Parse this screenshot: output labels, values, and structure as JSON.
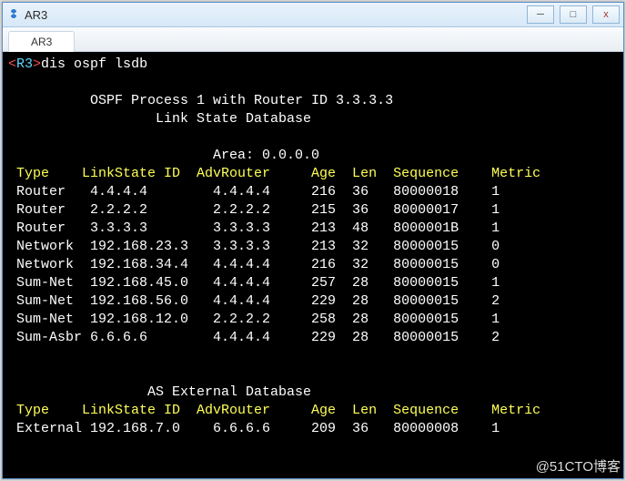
{
  "window": {
    "title": "AR3"
  },
  "tabs": [
    {
      "label": "AR3"
    }
  ],
  "terminal": {
    "prompt_open": "<",
    "hostname": "R3",
    "prompt_close": ">",
    "command": "dis ospf lsdb",
    "header_line1": "OSPF Process 1 with Router ID 3.3.3.3",
    "header_line2": "Link State Database",
    "area_line": "Area: 0.0.0.0",
    "cols": {
      "type": "Type",
      "lsid": "LinkState ID",
      "adv": "AdvRouter",
      "age": "Age",
      "len": "Len",
      "seq": "Sequence",
      "metric": "Metric"
    },
    "lsdb": [
      {
        "type": "Router",
        "lsid": "4.4.4.4",
        "adv": "4.4.4.4",
        "age": "216",
        "len": "36",
        "seq": "80000018",
        "metric": "1"
      },
      {
        "type": "Router",
        "lsid": "2.2.2.2",
        "adv": "2.2.2.2",
        "age": "215",
        "len": "36",
        "seq": "80000017",
        "metric": "1"
      },
      {
        "type": "Router",
        "lsid": "3.3.3.3",
        "adv": "3.3.3.3",
        "age": "213",
        "len": "48",
        "seq": "8000001B",
        "metric": "1"
      },
      {
        "type": "Network",
        "lsid": "192.168.23.3",
        "adv": "3.3.3.3",
        "age": "213",
        "len": "32",
        "seq": "80000015",
        "metric": "0"
      },
      {
        "type": "Network",
        "lsid": "192.168.34.4",
        "adv": "4.4.4.4",
        "age": "216",
        "len": "32",
        "seq": "80000015",
        "metric": "0"
      },
      {
        "type": "Sum-Net",
        "lsid": "192.168.45.0",
        "adv": "4.4.4.4",
        "age": "257",
        "len": "28",
        "seq": "80000015",
        "metric": "1"
      },
      {
        "type": "Sum-Net",
        "lsid": "192.168.56.0",
        "adv": "4.4.4.4",
        "age": "229",
        "len": "28",
        "seq": "80000015",
        "metric": "2"
      },
      {
        "type": "Sum-Net",
        "lsid": "192.168.12.0",
        "adv": "2.2.2.2",
        "age": "258",
        "len": "28",
        "seq": "80000015",
        "metric": "1"
      },
      {
        "type": "Sum-Asbr",
        "lsid": "6.6.6.6",
        "adv": "4.4.4.4",
        "age": "229",
        "len": "28",
        "seq": "80000015",
        "metric": "2"
      }
    ],
    "ext_header": "AS External Database",
    "ext": [
      {
        "type": "External",
        "lsid": "192.168.7.0",
        "adv": "6.6.6.6",
        "age": "209",
        "len": "36",
        "seq": "80000008",
        "metric": "1"
      }
    ]
  },
  "watermark": "@51CTO博客"
}
